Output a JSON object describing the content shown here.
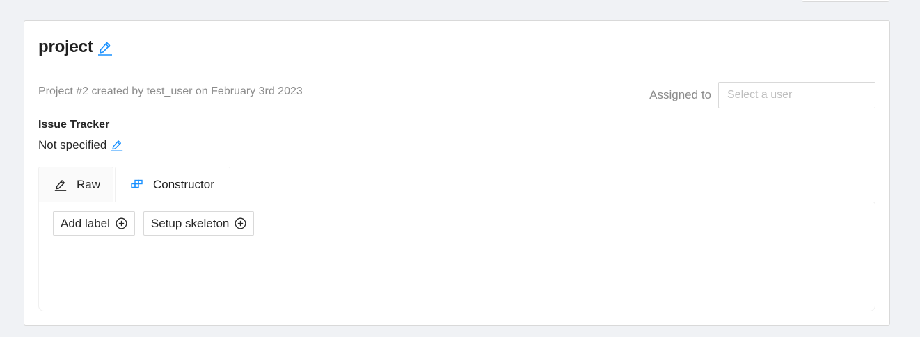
{
  "project": {
    "title": "project",
    "meta": "Project #2 created by test_user on February 3rd 2023"
  },
  "assignee": {
    "label": "Assigned to",
    "placeholder": "Select a user"
  },
  "issue_tracker": {
    "heading": "Issue Tracker",
    "value": "Not specified"
  },
  "tabs": [
    {
      "label": "Raw",
      "icon": "pencil-icon"
    },
    {
      "label": "Constructor",
      "icon": "blocks-icon",
      "active": true
    }
  ],
  "constructor": {
    "add_label": "Add label",
    "setup_skeleton": "Setup skeleton"
  },
  "colors": {
    "accent": "#1890ff",
    "page_background": "#f0f2f5",
    "muted_text": "#8c8c8c"
  }
}
